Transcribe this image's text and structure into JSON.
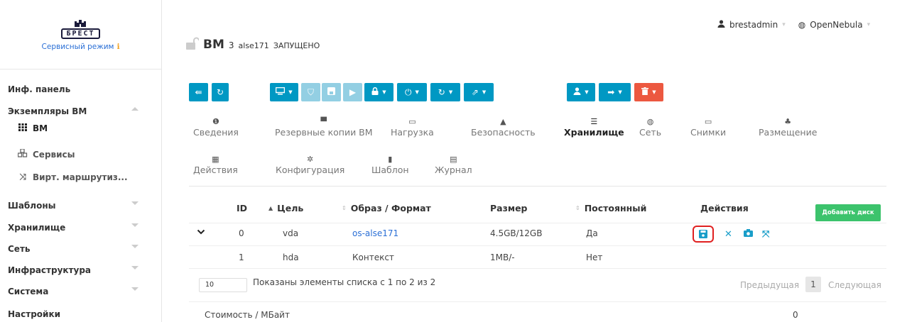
{
  "sidebar": {
    "logo_text": "БРЕСТ",
    "service_mode": "Сервисный режим",
    "service_mode_icon": "info-icon",
    "items": [
      {
        "label": "Инф. панель"
      },
      {
        "label": "Экземпляры ВМ",
        "expanded": true
      },
      {
        "label": "Шаблоны"
      },
      {
        "label": "Хранилище"
      },
      {
        "label": "Сеть"
      },
      {
        "label": "Инфраструктура"
      },
      {
        "label": "Система"
      },
      {
        "label": "Настройки"
      }
    ],
    "subitems": [
      {
        "label": "ВМ",
        "icon": "grid-icon",
        "active": true
      },
      {
        "label": "Сервисы",
        "icon": "cubes-icon"
      },
      {
        "label": "Вирт. маршрутиз...",
        "icon": "random-icon"
      }
    ]
  },
  "header": {
    "title": "ВМ",
    "vm_id": "3",
    "vm_name": "alse171",
    "vm_state": "ЗАПУЩЕНО",
    "user": "brestadmin",
    "zone": "OpenNebula"
  },
  "toolbar": {
    "colors": {
      "blue": "#0098c3",
      "blue_light": "#93cfe3",
      "red": "#ec5840"
    },
    "buttons": [
      {
        "name": "back-to-list-button",
        "icon": "list-back-icon"
      },
      {
        "name": "refresh-button",
        "icon": "refresh-icon"
      },
      {
        "name": "vnc-dropdown-button",
        "icon": "monitor-icon"
      },
      {
        "name": "deploy-button",
        "icon": "cart-icon",
        "disabled": true
      },
      {
        "name": "save-button",
        "icon": "save-icon",
        "disabled": true
      },
      {
        "name": "play-button",
        "icon": "play-icon",
        "disabled": true
      },
      {
        "name": "lock-dropdown-button",
        "icon": "lock-icon"
      },
      {
        "name": "power-dropdown-button",
        "icon": "power-icon"
      },
      {
        "name": "reboot-dropdown-button",
        "icon": "repeat-icon"
      },
      {
        "name": "migrate-dropdown-button",
        "icon": "share-icon"
      },
      {
        "name": "user-dropdown-button",
        "icon": "user-icon"
      },
      {
        "name": "tag-dropdown-button",
        "icon": "tag-icon"
      },
      {
        "name": "delete-dropdown-button",
        "icon": "trash-icon"
      }
    ]
  },
  "tabs": [
    {
      "label": "Сведения",
      "icon": "info-circle-icon"
    },
    {
      "label": "Резервные копии ВМ",
      "icon": "archive-icon"
    },
    {
      "label": "Нагрузка",
      "icon": "laptop-icon"
    },
    {
      "label": "Безопасность",
      "icon": "lock-icon"
    },
    {
      "label": "Хранилище",
      "icon": "server-icon",
      "active": true
    },
    {
      "label": "Сеть",
      "icon": "globe-icon"
    },
    {
      "label": "Снимки",
      "icon": "laptop-icon"
    },
    {
      "label": "Размещение",
      "icon": "sitemap-icon"
    },
    {
      "label": "Действия",
      "icon": "calendar-icon"
    },
    {
      "label": "Конфигурация",
      "icon": "cog-icon"
    },
    {
      "label": "Шаблон",
      "icon": "file-icon"
    },
    {
      "label": "Журнал",
      "icon": "file-text-icon"
    }
  ],
  "table": {
    "columns": [
      "ID",
      "Цель",
      "Образ / Формат",
      "Размер",
      "Постоянный",
      "Действия"
    ],
    "add_disk_label": "Добавить диск",
    "rows": [
      {
        "id": "0",
        "target": "vda",
        "image": "os-alse171",
        "size": "4.5GB/12GB",
        "persistent": "Да"
      },
      {
        "id": "1",
        "target": "hda",
        "image": "Контекст",
        "size": "1MB/-",
        "persistent": "Нет"
      }
    ],
    "row_actions": [
      "save-as-icon",
      "detach-icon",
      "snapshot-icon",
      "resize-icon"
    ]
  },
  "pagination": {
    "page_size": "10",
    "info": "Показаны элементы списка с 1 по 2 из 2",
    "prev": "Предыдущая",
    "current": "1",
    "next": "Следующая"
  },
  "cost": {
    "label": "Стоимость / МБайт",
    "value": "0"
  }
}
